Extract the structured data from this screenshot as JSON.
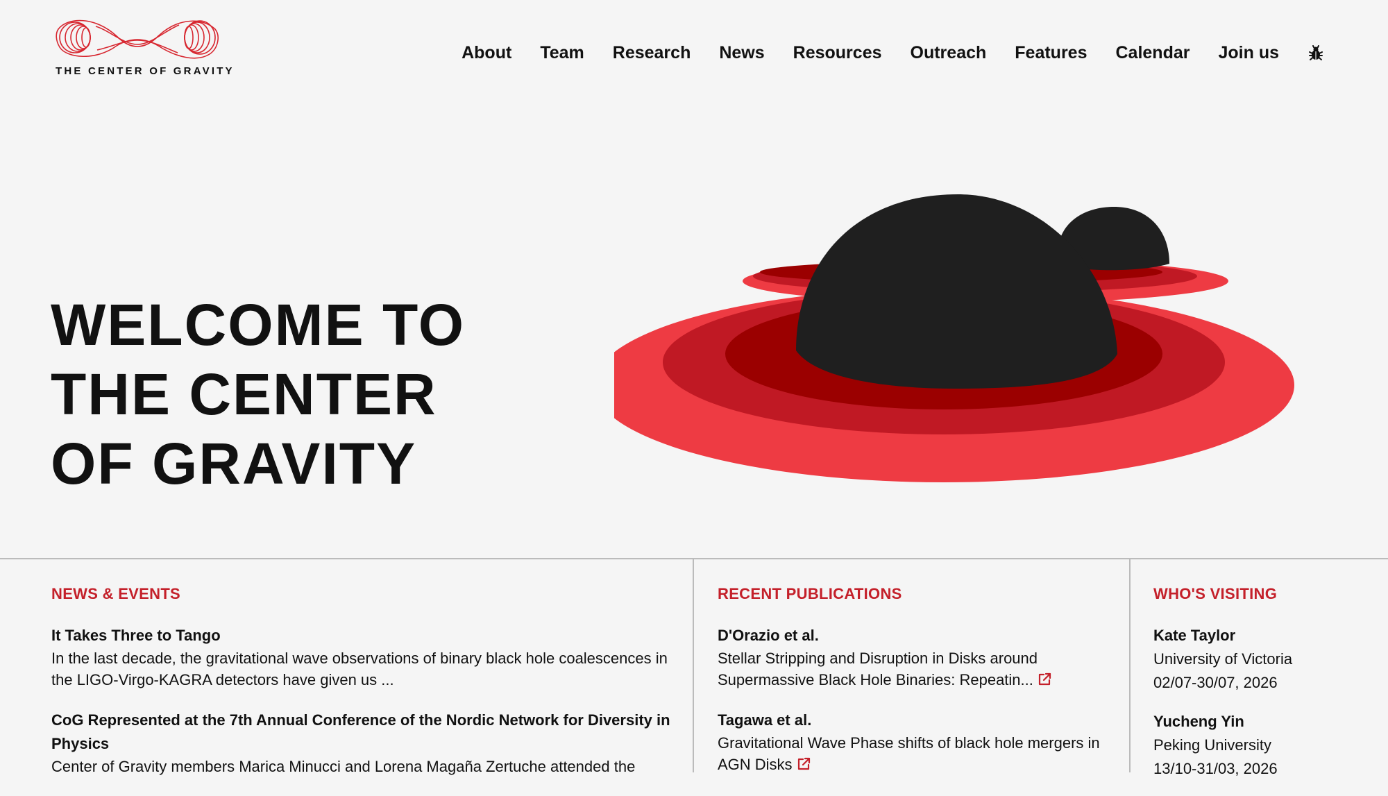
{
  "site": {
    "logo_text": "THE CENTER OF GRAVITY"
  },
  "nav": {
    "items": [
      "About",
      "Team",
      "Research",
      "News",
      "Resources",
      "Outreach",
      "Features",
      "Calendar",
      "Join us"
    ],
    "bug_icon": "bug-icon"
  },
  "hero": {
    "title_lines": [
      "WELCOME TO",
      "THE CENTER",
      "OF GRAVITY"
    ]
  },
  "colors": {
    "accent": "#c4202a",
    "ring_outer": "#ee3b43",
    "ring_mid": "#c01924",
    "ring_inner": "#9b0000",
    "blackhole": "#1f1f1f"
  },
  "news": {
    "heading": "NEWS & EVENTS",
    "items": [
      {
        "title": "It Takes Three to Tango",
        "body": "In the last decade, the gravitational wave observations of binary black hole coalescences in the LIGO-Virgo-KAGRA detectors have given us ..."
      },
      {
        "title": "CoG Represented at the 7th Annual Conference of the Nordic Network for Diversity in Physics",
        "body": "Center of Gravity members Marica Minucci and Lorena Magaña Zertuche attended the"
      }
    ]
  },
  "publications": {
    "heading": "RECENT PUBLICATIONS",
    "items": [
      {
        "authors": "D'Orazio et al.",
        "title": "Stellar Stripping and Disruption in Disks around Supermassive Black Hole Binaries: Repeatin..."
      },
      {
        "authors": "Tagawa et al.",
        "title": "Gravitational Wave Phase shifts of black hole mergers in AGN Disks"
      }
    ]
  },
  "visiting": {
    "heading": "WHO'S VISITING",
    "items": [
      {
        "name": "Kate Taylor",
        "institution": "University of Victoria",
        "dates": "02/07-30/07, 2026"
      },
      {
        "name": "Yucheng Yin",
        "institution": "Peking University",
        "dates": "13/10-31/03, 2026"
      }
    ]
  }
}
